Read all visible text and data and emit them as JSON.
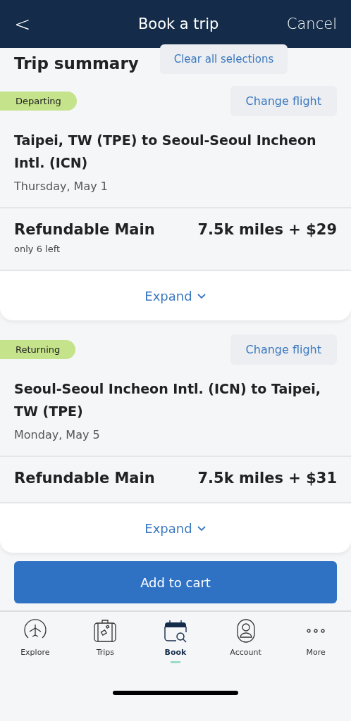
{
  "header": {
    "back": "<",
    "title": "Book a trip",
    "cancel": "Cancel"
  },
  "summary": {
    "title": "Trip summary",
    "clear": "Clear all selections"
  },
  "segments": [
    {
      "badge": "Departing",
      "change": "Change flight",
      "route": "Taipei, TW (TPE) to Seoul-Seoul Incheon Intl. (ICN)",
      "date": "Thursday, May 1",
      "fare": "Refundable Main",
      "price": "7.5k miles + $29",
      "note": "only 6 left",
      "expand": "Expand"
    },
    {
      "badge": "Returning",
      "change": "Change flight",
      "route": "Seoul-Seoul Incheon Intl. (ICN) to Taipei, TW (TPE)",
      "date": "Monday, May 5",
      "fare": "Refundable Main",
      "price": "7.5k miles + $31",
      "expand": "Expand"
    }
  ],
  "add_to_cart": "Add to cart",
  "nav": [
    {
      "label": "Explore",
      "selected": false
    },
    {
      "label": "Trips",
      "selected": false
    },
    {
      "label": "Book",
      "selected": true
    },
    {
      "label": "Account",
      "selected": false
    },
    {
      "label": "More",
      "selected": false
    }
  ]
}
